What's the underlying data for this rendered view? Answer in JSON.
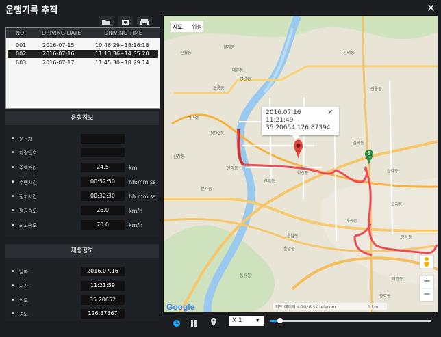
{
  "window": {
    "title": "운행기록 추적",
    "close_glyph": "✕"
  },
  "toolbar": {
    "icons": [
      "folder-icon",
      "camera-icon",
      "printer-icon"
    ]
  },
  "drive_table": {
    "columns": [
      "NO.",
      "DRIVING DATE",
      "DRIVING TIME"
    ],
    "rows": [
      {
        "no": "001",
        "date": "2016-07-15",
        "time": "10:46:29~18:16:18",
        "selected": false
      },
      {
        "no": "002",
        "date": "2016-07-16",
        "time": "11:13:36~14:35:20",
        "selected": true
      },
      {
        "no": "003",
        "date": "2016-07-17",
        "time": "11:45:30~18:29:14",
        "selected": false
      }
    ]
  },
  "drive_info": {
    "title": "운행정보",
    "rows": [
      {
        "label": "운전자",
        "value": "",
        "unit": ""
      },
      {
        "label": "차량번호",
        "value": "",
        "unit": ""
      },
      {
        "label": "주행거리",
        "value": "24.5",
        "unit": "km"
      },
      {
        "label": "주행시간",
        "value": "00:52:50",
        "unit": "hh:mm:ss"
      },
      {
        "label": "정지시간",
        "value": "00:32:30",
        "unit": "hh:mm:ss"
      },
      {
        "label": "평균속도",
        "value": "26.0",
        "unit": "km/h"
      },
      {
        "label": "최고속도",
        "value": "70.0",
        "unit": "km/h"
      }
    ]
  },
  "playback_info": {
    "title": "재생정보",
    "rows": [
      {
        "label": "날짜",
        "value": "2016.07.16"
      },
      {
        "label": "시간",
        "value": "11:21:59"
      },
      {
        "label": "위도",
        "value": "35.20652"
      },
      {
        "label": "경도",
        "value": "126.87367"
      }
    ]
  },
  "map": {
    "tabs": [
      "지도",
      "위성"
    ],
    "popup": {
      "date": "2016.07.16",
      "time": "11:21:49",
      "coords": "35.20654 126.87394"
    },
    "marker_label": "S",
    "google_logo": "Google",
    "copyright": "지도 데이터 ©2016 SK telecom",
    "scale": "1 km",
    "place_labels": [
      "산월동",
      "월계동",
      "쌍암동",
      "오룡동",
      "대촌동",
      "비아동",
      "첨단2동",
      "신창동",
      "산정동",
      "연제동",
      "신가동",
      "운남동",
      "본덕동",
      "신룡동",
      "양산동",
      "일곡동",
      "삼각동",
      "오치동",
      "매곡동",
      "운암동",
      "동림동",
      "장등동",
      "태령동",
      "충효동"
    ],
    "zoom_in": "+",
    "zoom_out": "−"
  },
  "playback": {
    "speed_value": "X 1",
    "progress_pct": 6
  },
  "colors": {
    "accent": "#21a9ff",
    "route": "#ea4d56",
    "route_dark": "#d4312d"
  }
}
